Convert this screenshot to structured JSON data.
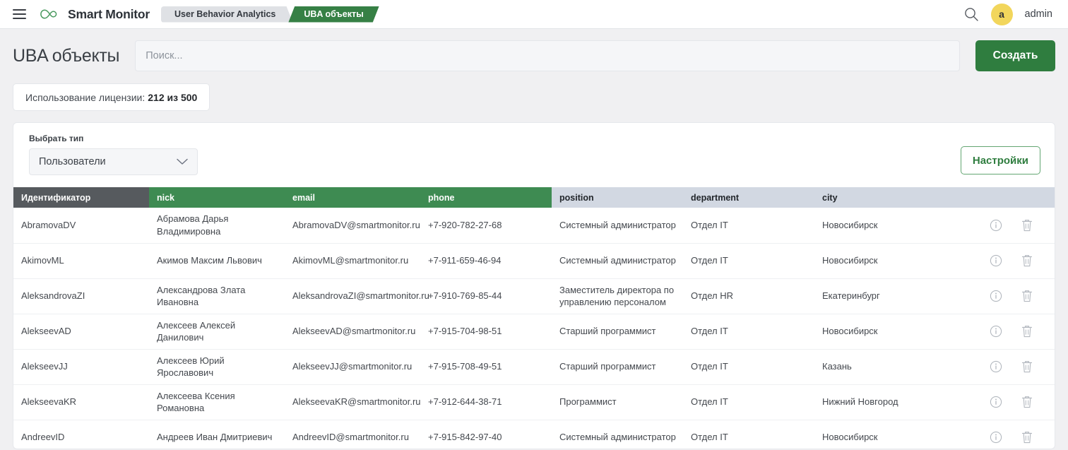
{
  "topbar": {
    "menu_icon": "hamburger-menu-icon",
    "logo_icon": "infinity-logo-icon",
    "brand": "Smart Monitor",
    "breadcrumbs": [
      {
        "label": "User Behavior Analytics",
        "active": false
      },
      {
        "label": "UBA объекты",
        "active": true
      }
    ],
    "search_icon": "search-icon",
    "avatar_initial": "a",
    "username": "admin"
  },
  "pagehead": {
    "title": "UBA объекты",
    "search_placeholder": "Поиск...",
    "search_value": "",
    "create_label": "Создать"
  },
  "license": {
    "label": "Использование лицензии:",
    "value": "212 из 500"
  },
  "filters": {
    "type_label": "Выбрать тип",
    "type_value": "Пользователи",
    "type_chevron_icon": "chevron-down-icon",
    "settings_label": "Настройки"
  },
  "colors": {
    "brand_green": "#368045",
    "button_green": "#2f7d3f",
    "header_green": "#3e8b52",
    "header_dark": "#565a5e",
    "header_gray": "#d2d8e2",
    "avatar_yellow": "#f2d65c"
  },
  "table": {
    "columns": [
      {
        "key": "id",
        "label": "Идентификатор",
        "style": "dark"
      },
      {
        "key": "nick",
        "label": "nick",
        "style": "green"
      },
      {
        "key": "email",
        "label": "email",
        "style": "green"
      },
      {
        "key": "phone",
        "label": "phone",
        "style": "green"
      },
      {
        "key": "position",
        "label": "position",
        "style": "gray"
      },
      {
        "key": "department",
        "label": "department",
        "style": "gray"
      },
      {
        "key": "city",
        "label": "city",
        "style": "gray"
      }
    ],
    "row_actions": [
      {
        "name": "info-icon",
        "title": "info"
      },
      {
        "name": "trash-icon",
        "title": "delete"
      }
    ],
    "rows": [
      {
        "id": "AbramovaDV",
        "nick": "Абрамова Дарья Владимировна",
        "email": "AbramovaDV@smartmonitor.ru",
        "phone": "+7-920-782-27-68",
        "position": "Системный администратор",
        "department": "Отдел IT",
        "city": "Новосибирск"
      },
      {
        "id": "AkimovML",
        "nick": "Акимов Максим Львович",
        "email": "AkimovML@smartmonitor.ru",
        "phone": "+7-911-659-46-94",
        "position": "Системный администратор",
        "department": "Отдел IT",
        "city": "Новосибирск"
      },
      {
        "id": "AleksandrovaZI",
        "nick": "Александрова Злата Ивановна",
        "email": "AleksandrovaZI@smartmonitor.ru",
        "phone": "+7-910-769-85-44",
        "position": "Заместитель директора по управлению персоналом",
        "department": "Отдел HR",
        "city": "Екатеринбург"
      },
      {
        "id": "AlekseevAD",
        "nick": "Алексеев Алексей Данилович",
        "email": "AlekseevAD@smartmonitor.ru",
        "phone": "+7-915-704-98-51",
        "position": "Старший программист",
        "department": "Отдел IT",
        "city": "Новосибирск"
      },
      {
        "id": "AlekseevJJ",
        "nick": "Алексеев Юрий Ярославович",
        "email": "AlekseevJJ@smartmonitor.ru",
        "phone": "+7-915-708-49-51",
        "position": "Старший программист",
        "department": "Отдел IT",
        "city": "Казань"
      },
      {
        "id": "AlekseevaKR",
        "nick": "Алексеева Ксения Романовна",
        "email": "AlekseevaKR@smartmonitor.ru",
        "phone": "+7-912-644-38-71",
        "position": "Программист",
        "department": "Отдел IT",
        "city": "Нижний Новгород"
      },
      {
        "id": "AndreevID",
        "nick": "Андреев Иван Дмитриевич",
        "email": "AndreevID@smartmonitor.ru",
        "phone": "+7-915-842-97-40",
        "position": "Системный администратор",
        "department": "Отдел IT",
        "city": "Новосибирск"
      }
    ]
  }
}
